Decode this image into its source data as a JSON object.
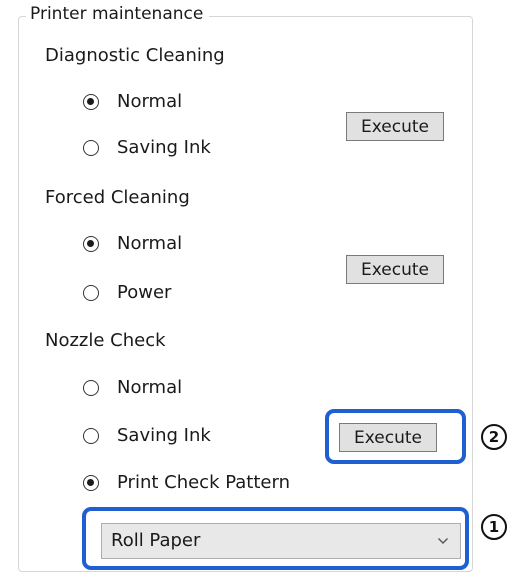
{
  "group": {
    "title": "Printer maintenance"
  },
  "diagnostic_cleaning": {
    "label": "Diagnostic Cleaning",
    "options": [
      {
        "label": "Normal",
        "checked": true
      },
      {
        "label": "Saving Ink",
        "checked": false
      }
    ],
    "execute_label": "Execute"
  },
  "forced_cleaning": {
    "label": "Forced Cleaning",
    "options": [
      {
        "label": "Normal",
        "checked": true
      },
      {
        "label": "Power",
        "checked": false
      }
    ],
    "execute_label": "Execute"
  },
  "nozzle_check": {
    "label": "Nozzle Check",
    "options": [
      {
        "label": "Normal",
        "checked": false
      },
      {
        "label": "Saving Ink",
        "checked": false
      },
      {
        "label": "Print Check Pattern",
        "checked": true
      }
    ],
    "execute_label": "Execute",
    "paper_source": {
      "selected": "Roll Paper"
    }
  },
  "callouts": {
    "one": "1",
    "two": "2"
  },
  "colors": {
    "highlight": "#1f5fd1",
    "button_bg": "#e1e1e1",
    "select_bg": "#e8e8e8"
  },
  "icons": {
    "dropdown": "chevron-down-icon",
    "callout": "numbered-circle-icon"
  }
}
